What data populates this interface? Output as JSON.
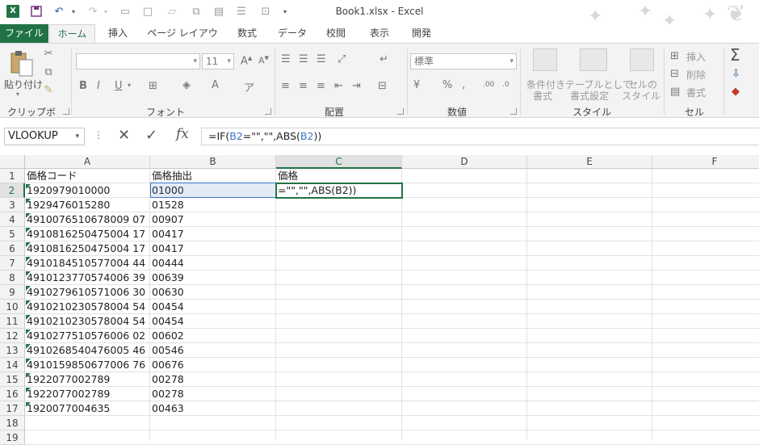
{
  "window": {
    "title": "Book1.xlsx - Excel"
  },
  "tabs": [
    {
      "label": "ファイル"
    },
    {
      "label": "ホーム"
    },
    {
      "label": "挿入"
    },
    {
      "label": "ページ レイアウト"
    },
    {
      "label": "数式"
    },
    {
      "label": "データ"
    },
    {
      "label": "校閲"
    },
    {
      "label": "表示"
    },
    {
      "label": "開発"
    }
  ],
  "ribbon": {
    "clipboard": {
      "paste_label": "貼り付け",
      "group_label": "クリップボード"
    },
    "font": {
      "size": "11",
      "group_label": "フォント"
    },
    "alignment": {
      "group_label": "配置"
    },
    "number": {
      "format": "標準",
      "group_label": "数値"
    },
    "styles": {
      "conditional_1": "条件付き",
      "conditional_2": "書式",
      "table_1": "テーブルとして",
      "table_2": "書式設定",
      "cell_1": "セルの",
      "cell_2": "スタイル",
      "group_label": "スタイル"
    },
    "cells": {
      "insert": "挿入",
      "delete": "削除",
      "format": "書式",
      "group_label": "セル"
    }
  },
  "formula_bar": {
    "name_box": "VLOOKUP",
    "formula_prefix": "=IF(",
    "ref1": "B2",
    "formula_mid": "=\"\",\"\",ABS(",
    "ref2": "B2",
    "formula_suffix": "))"
  },
  "columns": [
    "A",
    "B",
    "C",
    "D",
    "E",
    "F"
  ],
  "rows": [
    {
      "num": "1",
      "a": "価格コード",
      "b": "価格抽出",
      "c": "価格"
    },
    {
      "num": "2",
      "a": "1920979010000",
      "b": "01000",
      "c": "=\"\",\"\",ABS(B2))"
    },
    {
      "num": "3",
      "a": "1929476015280",
      "b": "01528",
      "c": ""
    },
    {
      "num": "4",
      "a": "4910076510678009 07",
      "b": "00907",
      "c": ""
    },
    {
      "num": "5",
      "a": "4910816250475004 17",
      "b": "00417",
      "c": ""
    },
    {
      "num": "6",
      "a": "4910816250475004 17",
      "b": "00417",
      "c": ""
    },
    {
      "num": "7",
      "a": "4910184510577004 44",
      "b": "00444",
      "c": ""
    },
    {
      "num": "8",
      "a": "4910123770574006 39",
      "b": "00639",
      "c": ""
    },
    {
      "num": "9",
      "a": "4910279610571006 30",
      "b": "00630",
      "c": ""
    },
    {
      "num": "10",
      "a": "4910210230578004 54",
      "b": "00454",
      "c": ""
    },
    {
      "num": "11",
      "a": "4910210230578004 54",
      "b": "00454",
      "c": ""
    },
    {
      "num": "12",
      "a": "4910277510576006 02",
      "b": "00602",
      "c": ""
    },
    {
      "num": "13",
      "a": "4910268540476005 46",
      "b": "00546",
      "c": ""
    },
    {
      "num": "14",
      "a": "4910159850677006 76",
      "b": "00676",
      "c": ""
    },
    {
      "num": "15",
      "a": "1922077002789",
      "b": "00278",
      "c": ""
    },
    {
      "num": "16",
      "a": "1922077002789",
      "b": "00278",
      "c": ""
    },
    {
      "num": "17",
      "a": "1920077004635",
      "b": "00463",
      "c": ""
    },
    {
      "num": "18",
      "a": "",
      "b": "",
      "c": ""
    },
    {
      "num": "19",
      "a": "",
      "b": "",
      "c": ""
    }
  ],
  "colors": {
    "accent": "#217346",
    "ref": "#3a74c4"
  }
}
